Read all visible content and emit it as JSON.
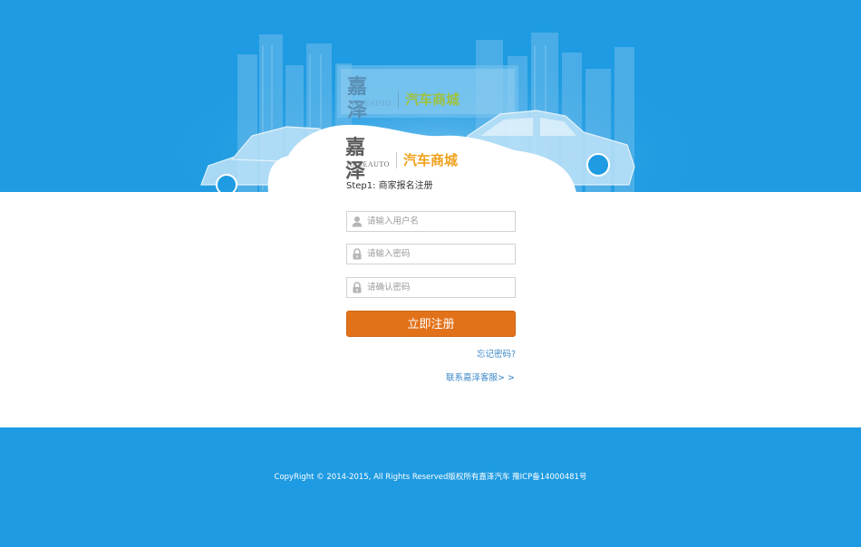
{
  "brand": {
    "logo_cn": "嘉泽",
    "logo_en": "JIAZEAUTO",
    "logo_sub": "汽车商城"
  },
  "form": {
    "step_title": "Step1: 商家报名注册",
    "username_placeholder": "请输入用户名",
    "password_placeholder": "请输入密码",
    "confirm_placeholder": "请确认密码",
    "submit_label": "立即注册",
    "forgot_link": "忘记密码?",
    "contact_link": "联系嘉泽客服> >"
  },
  "icons": {
    "username": "user-icon",
    "password": "lock-icon",
    "confirm": "lock-icon"
  },
  "footer": {
    "copyright": "CopyRight © 2014-2015, All Rights Reserved版权所有嘉泽汽车 豫ICP备14000481号"
  },
  "colors": {
    "brand_blue": "#1e9be2",
    "button_orange": "#e2721a",
    "link_blue": "#3a86c8",
    "logo_gold": "#f0a11b"
  }
}
